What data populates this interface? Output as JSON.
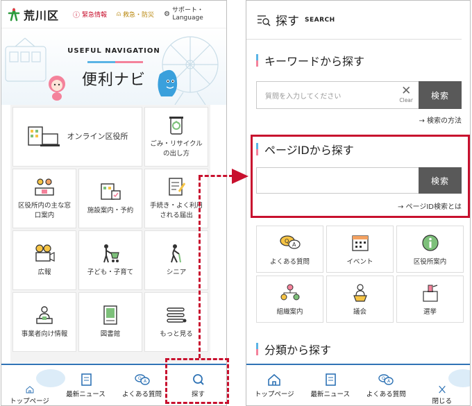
{
  "left": {
    "header": {
      "logo_text": "荒川区",
      "emergency": "緊急情報",
      "disaster": "救急・防災",
      "support_line1": "サポート・",
      "support_line2": "Language"
    },
    "hero": {
      "title": "USEFUL NAVIGATION",
      "subtitle": "便利ナビ"
    },
    "nav": [
      {
        "label": "オンライン区役所",
        "icon": "online-office-icon"
      },
      {
        "label": "ごみ・リサイクルの出し方",
        "icon": "recycle-icon"
      },
      {
        "label": "区役所内の主な窓口案内",
        "icon": "counter-icon"
      },
      {
        "label": "施設案内・予約",
        "icon": "facility-icon"
      },
      {
        "label": "手続き・よく利用される届出",
        "icon": "form-icon"
      },
      {
        "label": "広報",
        "icon": "camera-icon"
      },
      {
        "label": "子ども・子育て",
        "icon": "childcare-icon"
      },
      {
        "label": "シニア",
        "icon": "senior-icon"
      },
      {
        "label": "事業者向け情報",
        "icon": "business-icon"
      },
      {
        "label": "図書館",
        "icon": "library-icon"
      },
      {
        "label": "もっと見る",
        "icon": "more-icon"
      }
    ],
    "bottombar": [
      "トップページ",
      "最新ニュース",
      "よくある質問",
      "探す"
    ]
  },
  "right": {
    "head": {
      "title": "探す",
      "subtitle": "SEARCH"
    },
    "keyword": {
      "title": "キーワードから探す",
      "placeholder": "質問を入力してください",
      "clear": "Clear",
      "button": "検索",
      "link": "→ 検索の方法"
    },
    "pageid": {
      "title": "ページIDから探す",
      "button": "検索",
      "link": "→ ページID検索とは"
    },
    "quick": [
      {
        "label": "よくある質問",
        "icon": "faq-icon"
      },
      {
        "label": "イベント",
        "icon": "calendar-icon"
      },
      {
        "label": "区役所案内",
        "icon": "info-icon"
      },
      {
        "label": "組織案内",
        "icon": "org-icon"
      },
      {
        "label": "議会",
        "icon": "assembly-icon"
      },
      {
        "label": "選挙",
        "icon": "election-icon"
      }
    ],
    "category": {
      "title": "分類から探す"
    },
    "bottombar": [
      "トップページ",
      "最新ニュース",
      "よくある質問",
      "閉じる"
    ]
  },
  "colors": {
    "accent_blue": "#2f73b5",
    "accent_red": "#c8102e",
    "button_grey": "#595959"
  }
}
